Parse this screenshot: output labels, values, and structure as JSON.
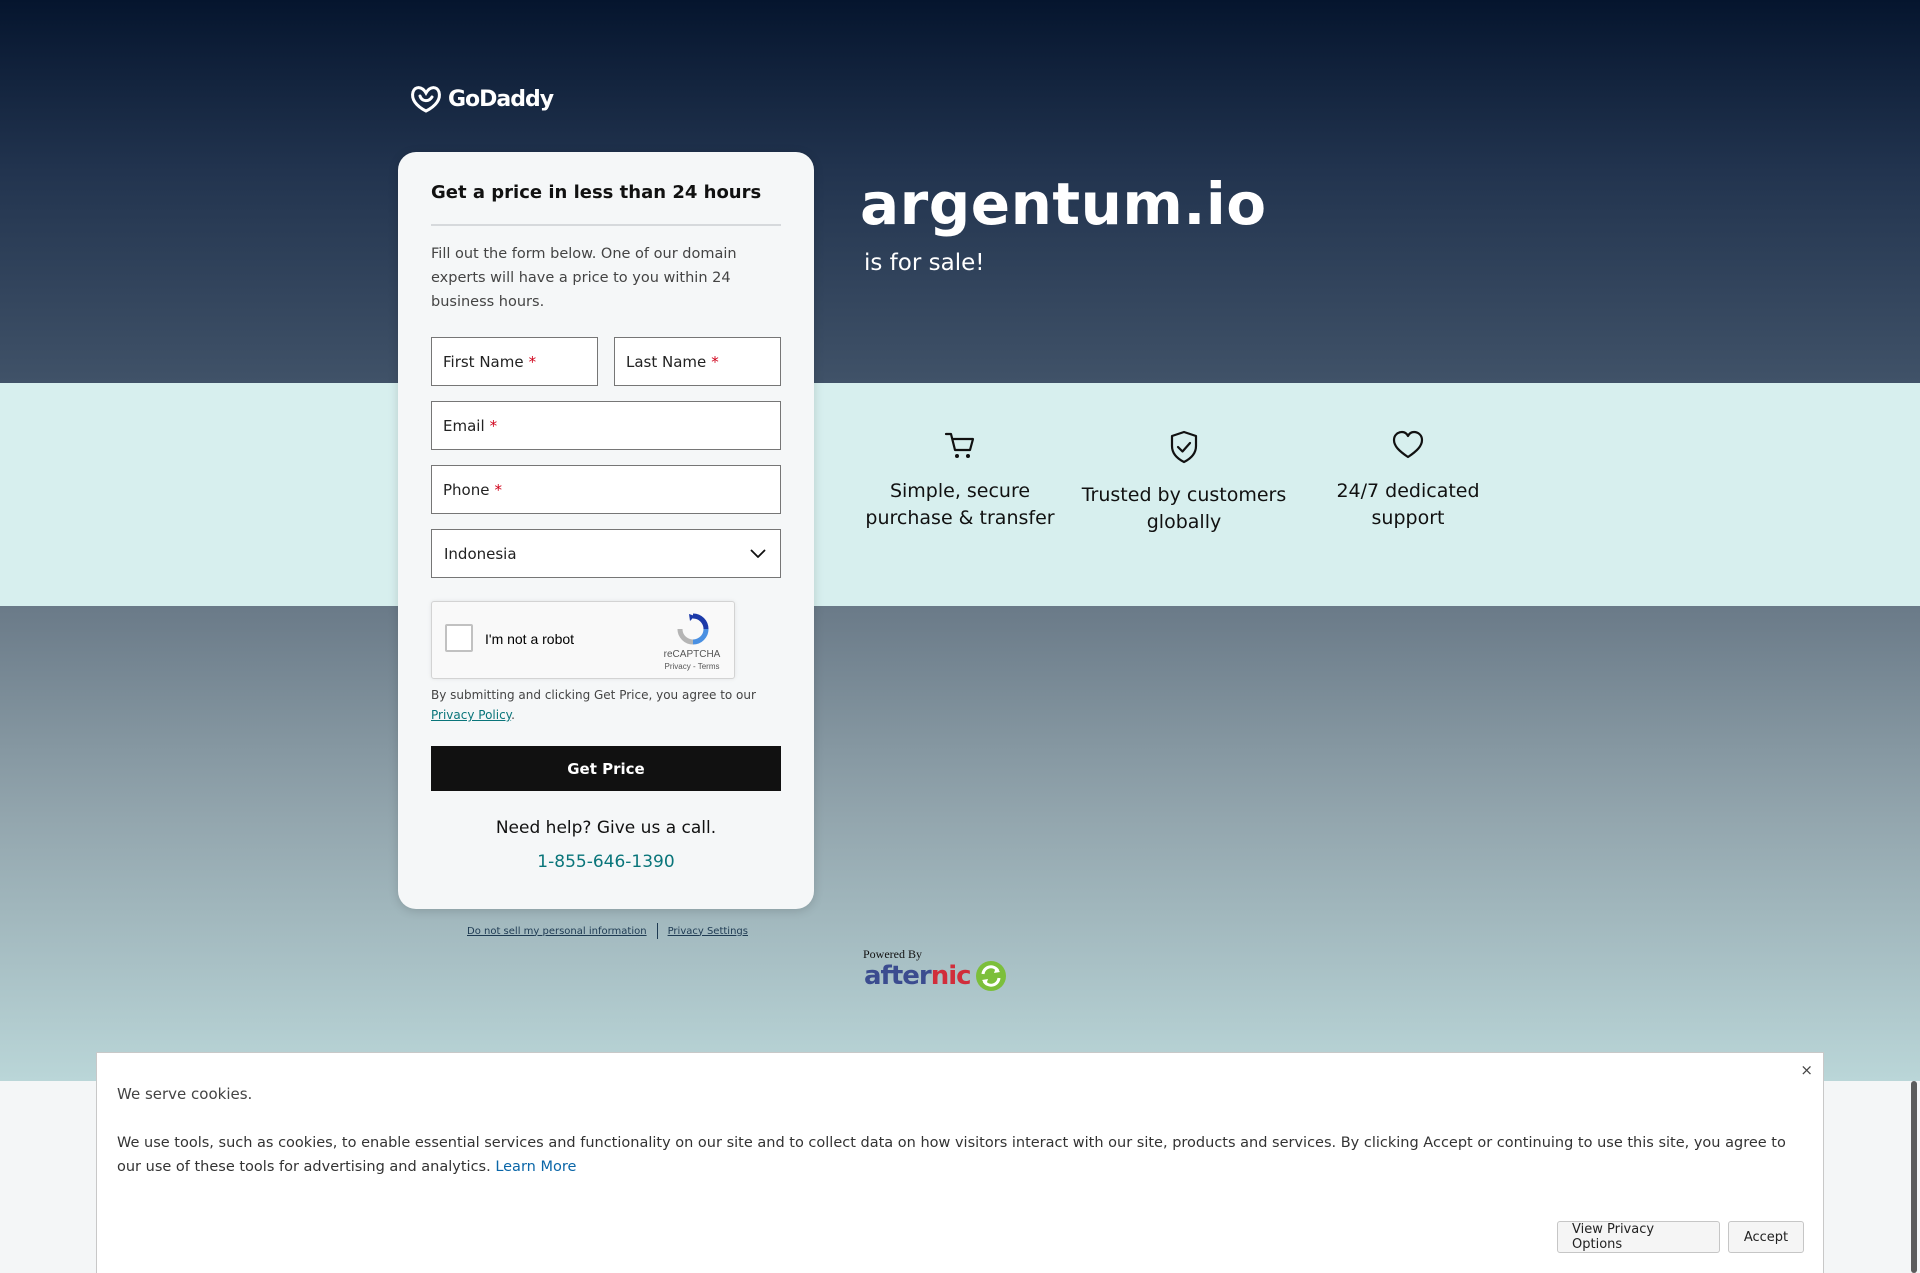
{
  "brand": {
    "logo_text": "GoDaddy"
  },
  "hero": {
    "domain": "argentum.io",
    "subtitle": "is for sale!"
  },
  "features": [
    {
      "icon": "cart-icon",
      "text": "Simple, secure purchase & transfer"
    },
    {
      "icon": "shield-check-icon",
      "text": "Trusted by customers globally"
    },
    {
      "icon": "heart-icon",
      "text": "24/7 dedicated support"
    }
  ],
  "form": {
    "title": "Get a price in less than 24 hours",
    "intro": "Fill out the form below. One of our domain experts will have a price to you within 24 business hours.",
    "first_name_label": "First Name",
    "last_name_label": "Last Name",
    "email_label": "Email",
    "phone_label": "Phone",
    "required_mark": "*",
    "country_value": "Indonesia",
    "captcha": {
      "label": "I'm not a robot",
      "brand": "reCAPTCHA",
      "privacy": "Privacy",
      "separator": "-",
      "terms": "Terms"
    },
    "agreement_text": "By submitting and clicking Get Price, you agree to our",
    "privacy_policy_link": "Privacy Policy",
    "agreement_end": ".",
    "submit_label": "Get Price",
    "help_text": "Need help? Give us a call.",
    "phone_number": "1-855-646-1390"
  },
  "footer": {
    "do_not_sell": "Do not sell my personal information",
    "privacy_settings": "Privacy Settings",
    "powered_by": "Powered By",
    "afternic_after": "after",
    "afternic_nic": "nic"
  },
  "cookie_banner": {
    "title": "We serve cookies.",
    "body": "We use tools, such as cookies, to enable essential services and functionality on our site and to collect data on how visitors interact with our site, products and services. By clicking Accept or continuing to use this site, you agree to our use of these tools for advertising and analytics.",
    "learn_more": "Learn More",
    "close": "×",
    "view_options_label": "View Privacy Options",
    "accept_label": "Accept"
  },
  "colors": {
    "hero_top": "#05152e",
    "band": "#d7efee",
    "accent_teal": "#09757a",
    "button_dark": "#111111",
    "required_red": "#d0021b"
  }
}
